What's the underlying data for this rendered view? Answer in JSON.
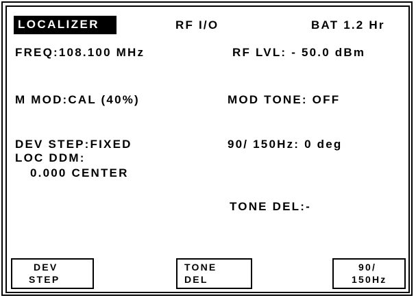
{
  "header": {
    "mode": "LOCALIZER",
    "rf_io": "RF I/O",
    "battery": "BAT 1.2 Hr"
  },
  "params": {
    "freq": "FREQ:108.100 MHz",
    "rf_level": "RF LVL: - 50.0 dBm",
    "m_mod": "M MOD:CAL (40%)",
    "mod_tone": "MOD TONE: OFF",
    "dev_step": "DEV STEP:FIXED",
    "phase": "90/ 150Hz:  0 deg",
    "loc_ddm_label": "LOC DDM:",
    "loc_ddm_value": "0.000 CENTER",
    "tone_del": "TONE DEL:-"
  },
  "softkeys": [
    {
      "line1": "DEV",
      "line2": "STEP"
    },
    {
      "line1": "TONE",
      "line2": "DEL"
    },
    {
      "line1": "90/",
      "line2": "150Hz"
    }
  ]
}
